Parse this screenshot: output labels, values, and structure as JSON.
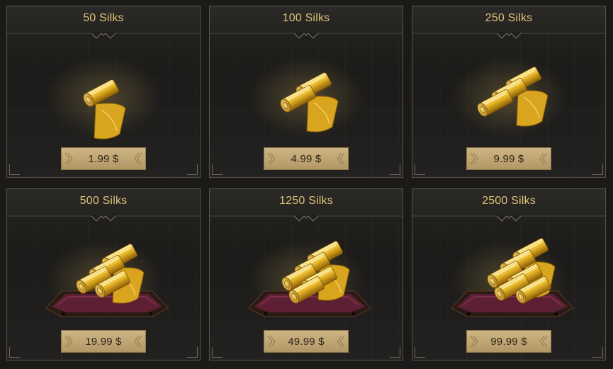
{
  "shop": {
    "currency_icon": "silk-bundle-icon",
    "colors": {
      "title_gold": "#e1c27a",
      "price_button_bg": "#c4aa78",
      "price_text": "#2c2418",
      "card_border": "#55524c",
      "velvet_cushion": "#5c1f33"
    },
    "packs": [
      {
        "title": "50 Silks",
        "price": "1.99 $",
        "rolls": 1,
        "cushion": false
      },
      {
        "title": "100 Silks",
        "price": "4.99 $",
        "rolls": 2,
        "cushion": false
      },
      {
        "title": "250 Silks",
        "price": "9.99 $",
        "rolls": 3,
        "cushion": false
      },
      {
        "title": "500 Silks",
        "price": "19.99 $",
        "rolls": 4,
        "cushion": true
      },
      {
        "title": "1250 Silks",
        "price": "49.99 $",
        "rolls": 5,
        "cushion": true
      },
      {
        "title": "2500 Silks",
        "price": "99.99 $",
        "rolls": 6,
        "cushion": true
      }
    ]
  }
}
